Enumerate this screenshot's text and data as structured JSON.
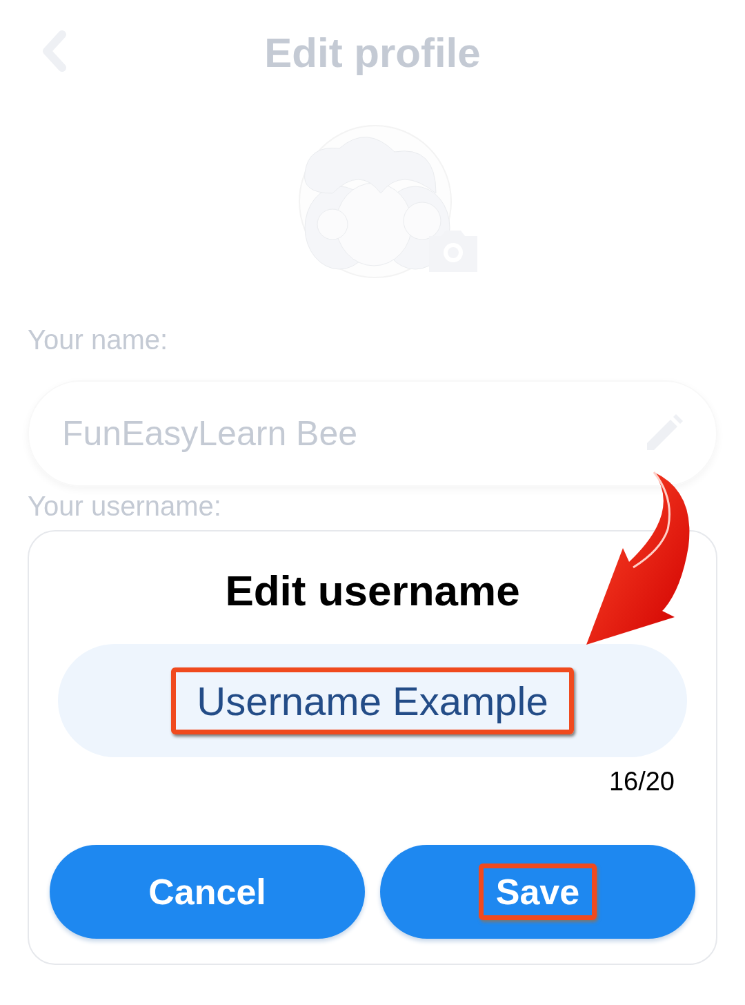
{
  "header": {
    "title": "Edit profile"
  },
  "profile": {
    "name_label": "Your name:",
    "name_value": "FunEasyLearn Bee",
    "username_label": "Your username:"
  },
  "dialog": {
    "title": "Edit username",
    "input_value": "Username Example",
    "input_highlighted": true,
    "counter": "16/20",
    "buttons": [
      {
        "label": "Cancel",
        "highlighted": false
      },
      {
        "label": "Save",
        "highlighted": true
      }
    ]
  }
}
